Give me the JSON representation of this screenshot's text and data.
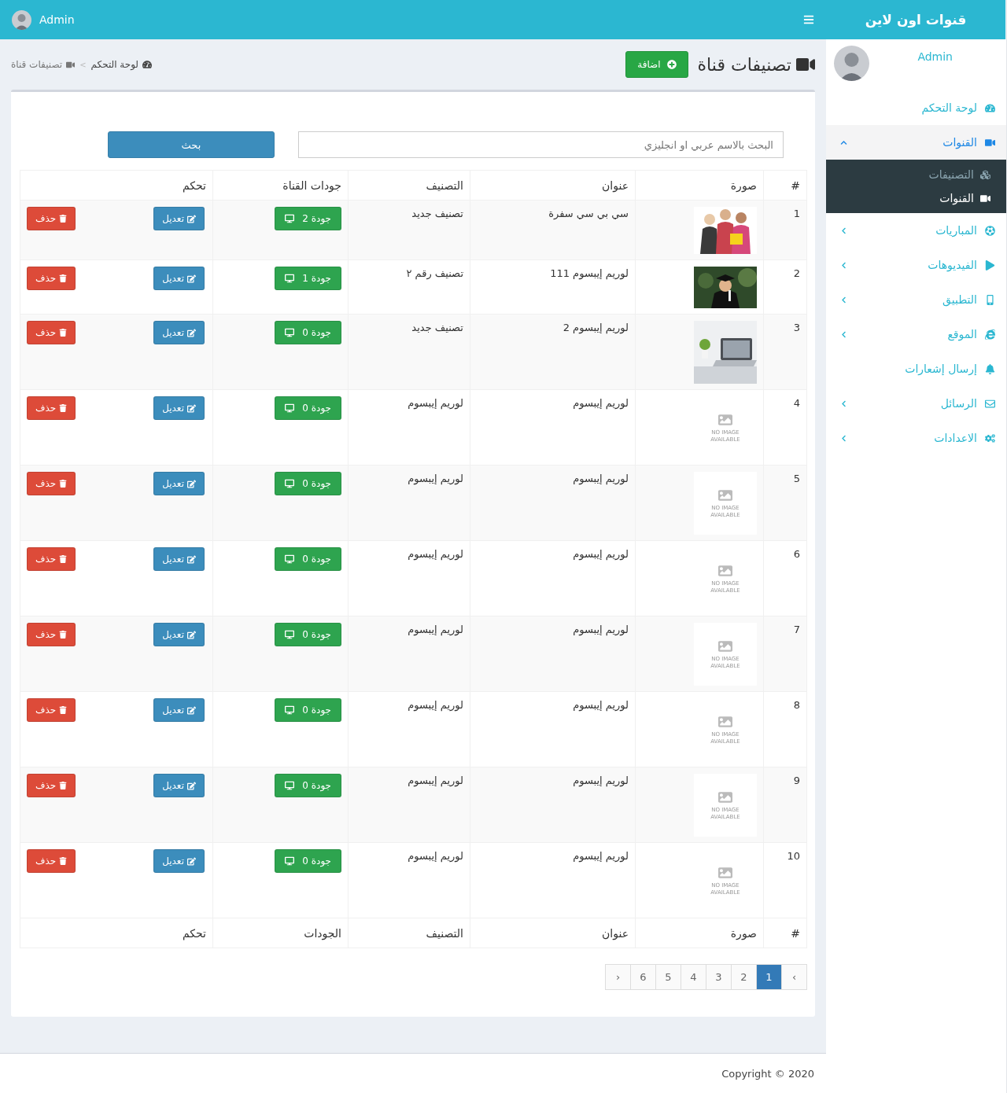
{
  "sidebar": {
    "brand": "قنوات اون لاين",
    "user": {
      "name": "Admin"
    },
    "menu": [
      {
        "label": "لوحة التحكم"
      },
      {
        "label": "القنوات",
        "expanded": true,
        "children": [
          {
            "label": "التصنيفات",
            "selected": false
          },
          {
            "label": "القنوات",
            "selected": true
          }
        ]
      },
      {
        "label": "المباريات",
        "expanded": false
      },
      {
        "label": "الفيديوهات",
        "expanded": false
      },
      {
        "label": "التطبيق",
        "expanded": false
      },
      {
        "label": "الموقع",
        "expanded": false
      },
      {
        "label": "إرسال إشعارات"
      },
      {
        "label": "الرسائل",
        "expanded": false
      },
      {
        "label": "الاعدادات",
        "expanded": false
      }
    ]
  },
  "topbar": {
    "user": "Admin"
  },
  "page": {
    "title": "تصنيفات قناة",
    "add_button": "اضافة",
    "breadcrumb": {
      "items": [
        "لوحة التحكم",
        "تصنيفات قناة"
      ],
      "separator": ">"
    }
  },
  "search": {
    "placeholder": "البحث بالاسم عربي او انجليزي",
    "button": "بحث"
  },
  "table": {
    "columns": [
      "#",
      "صورة",
      "عنوان",
      "التصنيف",
      "جودات القناة",
      "تحكم"
    ],
    "footer_columns": [
      "#",
      "صورة",
      "عنوان",
      "التصنيف",
      "الجودات",
      "تحكم"
    ],
    "rows": [
      {
        "number": "1",
        "title": "سي بي سي سفرة",
        "category": "تصنيف جديد",
        "qualities": "جودة 2",
        "edit": "تعديل",
        "delete": "حذف"
      },
      {
        "number": "2",
        "title": "لوريم إيبسوم 111",
        "category": "تصنيف رقم ٢",
        "qualities": "جودة 1",
        "edit": "تعديل",
        "delete": "حذف"
      },
      {
        "number": "3",
        "title": "لوريم إيبسوم 2",
        "category": "تصنيف جديد",
        "qualities": "جودة 0",
        "edit": "تعديل",
        "delete": "حذف"
      },
      {
        "number": "4",
        "image": {
          "kind": "placeholder",
          "text": "NO IMAGE AVAILABLE"
        },
        "title": "لوريم إيبسوم",
        "category": "لوريم إيبسوم",
        "qualities": "جودة 0",
        "edit": "تعديل",
        "delete": "حذف"
      },
      {
        "number": "5",
        "image": {
          "kind": "placeholder",
          "text": "NO IMAGE AVAILABLE"
        },
        "title": "لوريم إيبسوم",
        "category": "لوريم إيبسوم",
        "qualities": "جودة 0",
        "edit": "تعديل",
        "delete": "حذف"
      },
      {
        "number": "6",
        "image": {
          "kind": "placeholder",
          "text": "NO IMAGE AVAILABLE"
        },
        "title": "لوريم إيبسوم",
        "category": "لوريم إيبسوم",
        "qualities": "جودة 0",
        "edit": "تعديل",
        "delete": "حذف"
      },
      {
        "number": "7",
        "image": {
          "kind": "placeholder",
          "text": "NO IMAGE AVAILABLE"
        },
        "title": "لوريم إيبسوم",
        "category": "لوريم إيبسوم",
        "qualities": "جودة 0",
        "edit": "تعديل",
        "delete": "حذف"
      },
      {
        "number": "8",
        "image": {
          "kind": "placeholder",
          "text": "NO IMAGE AVAILABLE"
        },
        "title": "لوريم إيبسوم",
        "category": "لوريم إيبسوم",
        "qualities": "جودة 0",
        "edit": "تعديل",
        "delete": "حذف"
      },
      {
        "number": "9",
        "image": {
          "kind": "placeholder",
          "text": "NO IMAGE AVAILABLE"
        },
        "title": "لوريم إيبسوم",
        "category": "لوريم إيبسوم",
        "qualities": "جودة 0",
        "edit": "تعديل",
        "delete": "حذف"
      },
      {
        "number": "10",
        "image": {
          "kind": "placeholder",
          "text": "NO IMAGE AVAILABLE"
        },
        "title": "لوريم إيبسوم",
        "category": "لوريم إيبسوم",
        "qualities": "جودة 0",
        "edit": "تعديل",
        "delete": "حذف"
      }
    ]
  },
  "pagination": {
    "prev": "›",
    "pages": [
      {
        "label": "1",
        "selected": true
      },
      {
        "label": "2",
        "selected": false
      },
      {
        "label": "3",
        "selected": false
      },
      {
        "label": "4",
        "selected": false
      },
      {
        "label": "5",
        "selected": false
      },
      {
        "label": "6",
        "selected": false
      }
    ],
    "next": "‹"
  },
  "footer": {
    "copyright": "Copyright © 2020"
  }
}
